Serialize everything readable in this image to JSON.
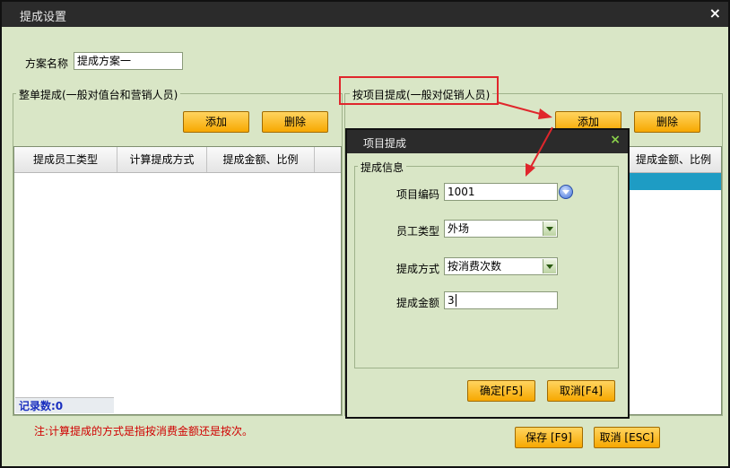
{
  "window": {
    "title": "提成设置",
    "close": "×"
  },
  "scheme": {
    "label": "方案名称",
    "value": "提成方案一"
  },
  "left_group": {
    "title": "整单提成(一般对值台和营销人员)",
    "add": "添加",
    "delete": "删除",
    "columns": [
      "提成员工类型",
      "计算提成方式",
      "提成金额、比例"
    ],
    "record_count": "记录数:0"
  },
  "right_group": {
    "title": "按项目提成(一般对促销人员)",
    "add": "添加",
    "delete": "删除",
    "column_partial": "提成金额、比例"
  },
  "note": "注:计算提成的方式是指按消费金额还是按次。",
  "footer": {
    "save": "保存 [F9]",
    "cancel": "取消 [ESC]"
  },
  "dialog": {
    "title": "项目提成",
    "close": "×",
    "group_title": "提成信息",
    "fields": {
      "item_code": {
        "label": "项目编码",
        "value": "1001"
      },
      "employee_type": {
        "label": "员工类型",
        "value": "外场"
      },
      "method": {
        "label": "提成方式",
        "value": "按消费次数"
      },
      "amount": {
        "label": "提成金额",
        "value": "3"
      }
    },
    "ok": "确定[F5]",
    "cancel": "取消[F4]"
  },
  "colors": {
    "annotation": "#e0262c",
    "selected_row": "#1e9cc4",
    "window_bg": "#d9e6c6"
  }
}
